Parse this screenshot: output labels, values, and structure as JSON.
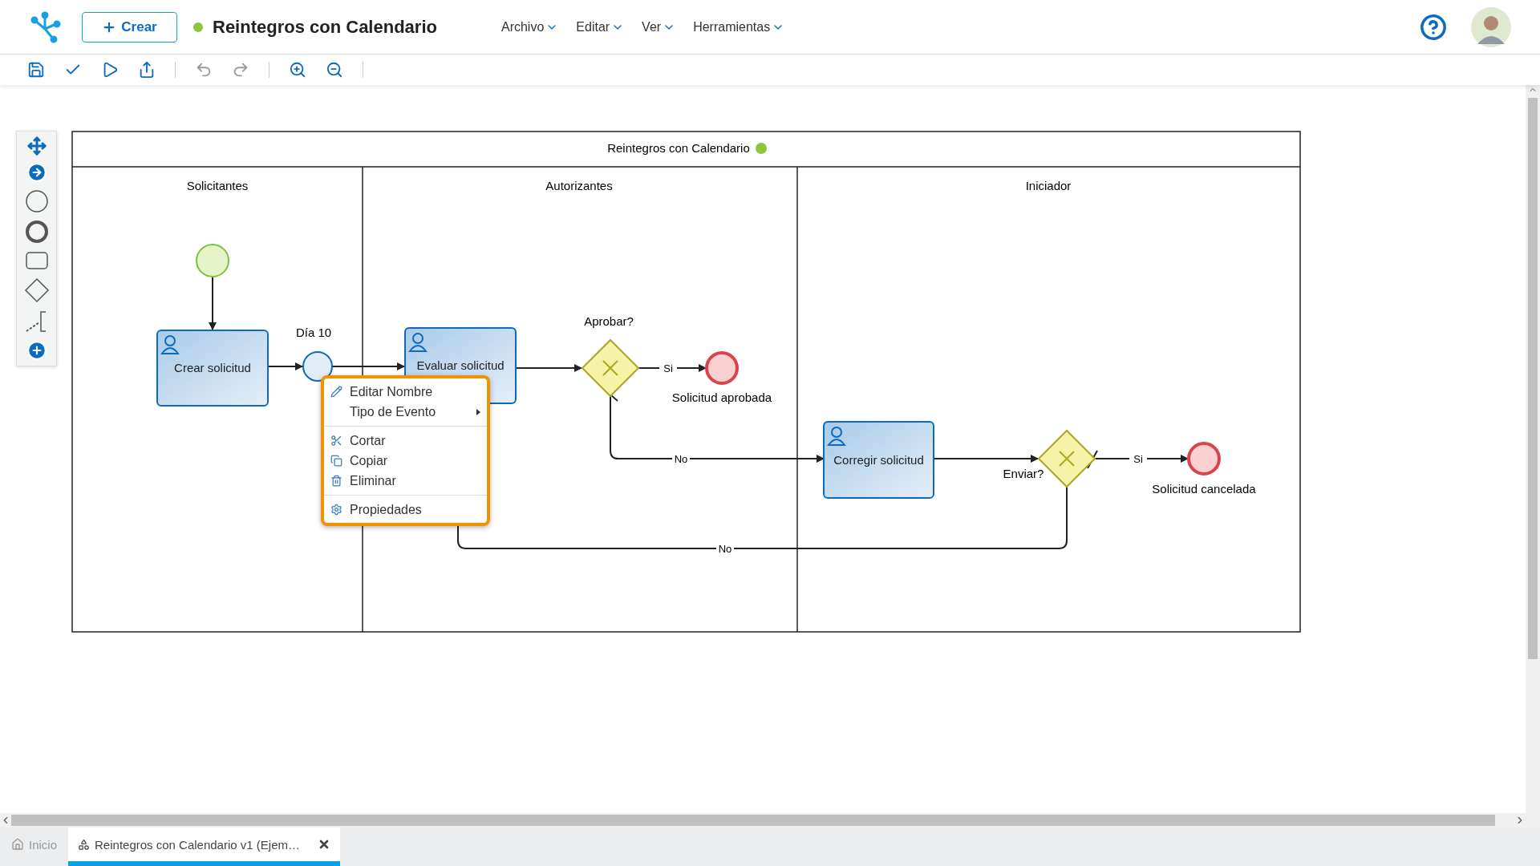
{
  "header": {
    "create_button": "Crear",
    "title": "Reintegros con Calendario",
    "menus": [
      "Archivo",
      "Editar",
      "Ver",
      "Herramientas"
    ]
  },
  "diagram": {
    "pool_title": "Reintegros con Calendario",
    "lanes": [
      "Solicitantes",
      "Autorizantes",
      "Iniciador"
    ],
    "nodes": [
      {
        "kind": "start"
      },
      {
        "kind": "task",
        "label": "Crear solicitud"
      },
      {
        "kind": "timer",
        "label": "Día 10"
      },
      {
        "kind": "task",
        "label": "Evaluar solicitud"
      },
      {
        "kind": "gateway",
        "label": "Aprobar?"
      },
      {
        "kind": "end",
        "label": "Solicitud aprobada"
      },
      {
        "kind": "task",
        "label": "Corregir solicitud"
      },
      {
        "kind": "gateway",
        "label": "Enviar?"
      },
      {
        "kind": "end",
        "label": "Solicitud cancelada"
      }
    ],
    "flows": [
      {
        "label": "Si"
      },
      {
        "label": "No"
      },
      {
        "label": "Si"
      },
      {
        "label": "No"
      }
    ]
  },
  "context_menu": [
    {
      "kind": "item",
      "label": "Editar Nombre"
    },
    {
      "kind": "submenu",
      "label": "Tipo de Evento"
    },
    {
      "kind": "separator"
    },
    {
      "kind": "item",
      "label": "Cortar"
    },
    {
      "kind": "item",
      "label": "Copiar"
    },
    {
      "kind": "item",
      "label": "Eliminar"
    },
    {
      "kind": "separator"
    },
    {
      "kind": "item",
      "label": "Propiedades"
    }
  ],
  "tabs": [
    {
      "label": "Inicio",
      "selected": false
    },
    {
      "label": "Reintegros con Calendario v1 (Ejem…",
      "selected": true
    }
  ]
}
